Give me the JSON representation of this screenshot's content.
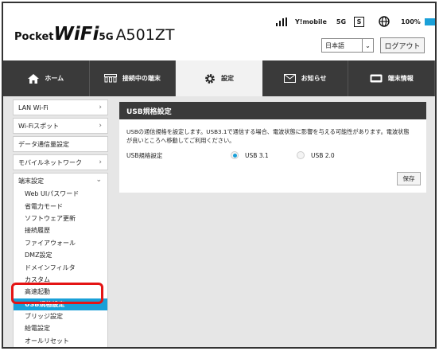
{
  "header": {
    "logo_part1": "Pocket",
    "logo_part2": "WiFi",
    "logo_part3": "5G",
    "logo_part4": "A501ZT",
    "status": {
      "carrier": "Y!mobile",
      "network": "5G",
      "sim_label": "S",
      "battery": "100%",
      "signal_icon": "signal-bars-icon",
      "globe_icon": "globe-icon"
    },
    "language": "日本語",
    "logout_label": "ログアウト"
  },
  "nav": {
    "tabs": [
      {
        "label": "ホーム",
        "icon": "home-icon"
      },
      {
        "label": "接続中の端末",
        "icon": "devices-icon"
      },
      {
        "label": "設定",
        "icon": "gear-icon",
        "active": true
      },
      {
        "label": "お知らせ",
        "icon": "mail-icon"
      },
      {
        "label": "端末情報",
        "icon": "device-info-icon"
      }
    ]
  },
  "sidebar": {
    "items": [
      {
        "label": "LAN Wi-Fi",
        "arrow": "›"
      },
      {
        "label": "Wi-Fiスポット",
        "arrow": "›"
      },
      {
        "label": "データ通信量設定",
        "arrow": ""
      },
      {
        "label": "モバイルネットワーク",
        "arrow": "›"
      }
    ],
    "group": {
      "label": "端末設定",
      "arrow": "⌄",
      "items": [
        "Web UIパスワード",
        "省電力モード",
        "ソフトウェア更新",
        "接続履歴",
        "ファイアウォール",
        "DMZ設定",
        "ドメインフィルタ",
        "カスタム",
        "高速起動",
        "USB規格設定",
        "ブリッジ設定",
        "給電設定",
        "オールリセット"
      ],
      "active_index": 9
    }
  },
  "panel": {
    "title": "USB規格設定",
    "description": "USBの通信規格を設定します。USB3.1で通信する場合、電波状態に影響を与える可能性があります。電波状態が良いところへ移動してご利用ください。",
    "setting_label": "USB規格設定",
    "options": [
      {
        "label": "USB 3.1",
        "selected": true
      },
      {
        "label": "USB 2.0",
        "selected": false
      }
    ],
    "save_label": "保存"
  }
}
